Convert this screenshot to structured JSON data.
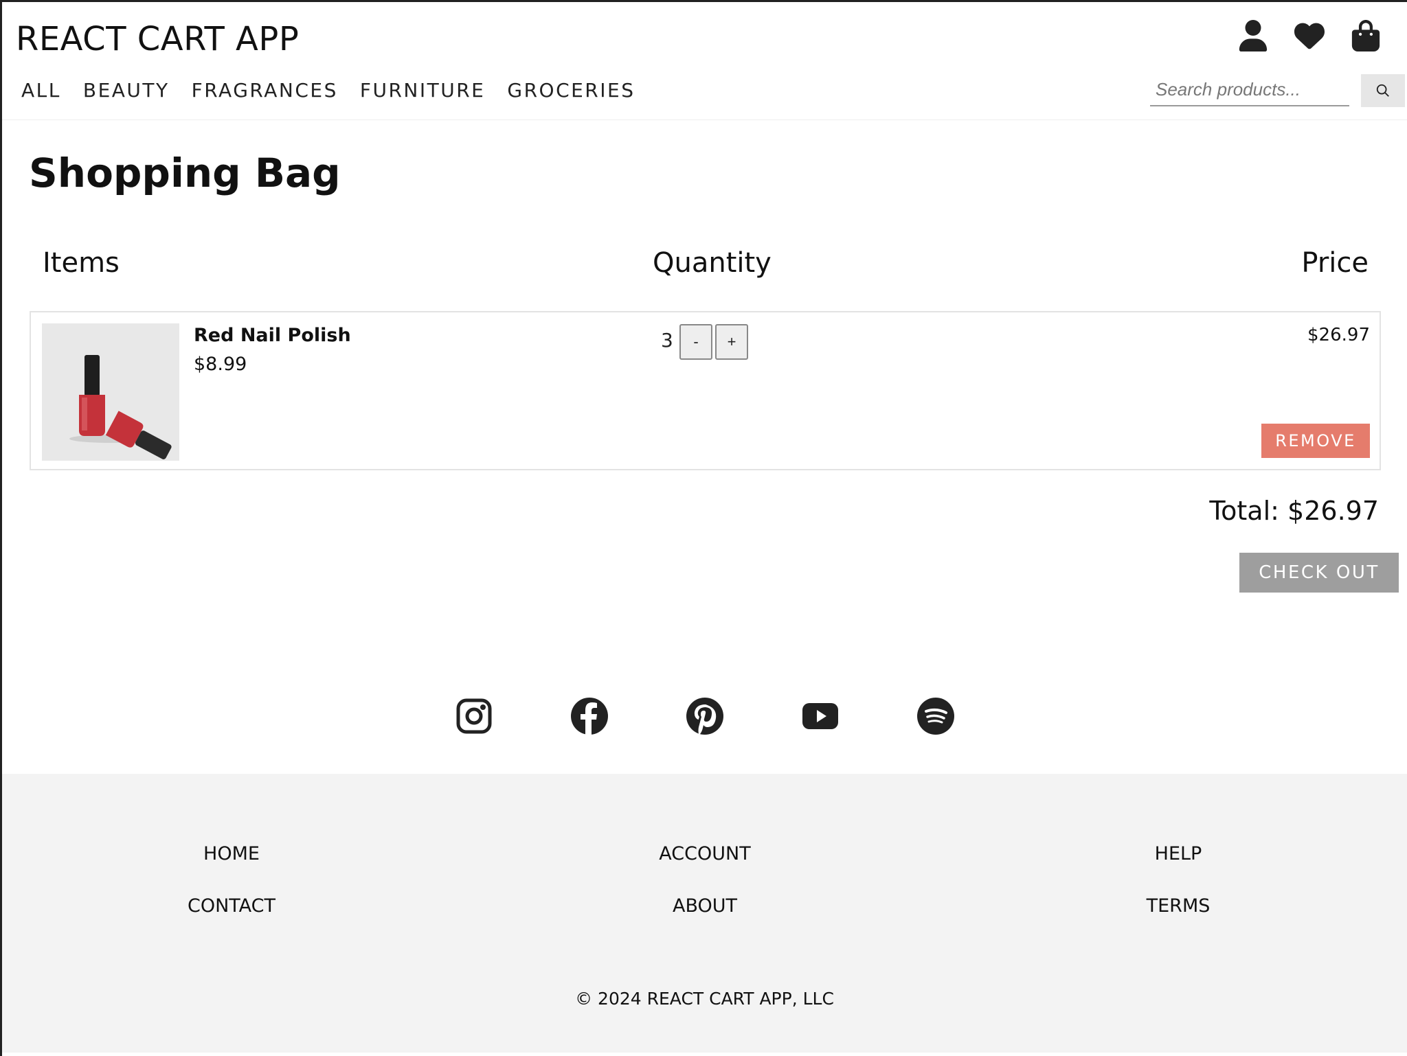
{
  "header": {
    "brand": "REACT CART APP",
    "icons": [
      "user-icon",
      "heart-icon",
      "shopping-bag-icon"
    ],
    "nav": [
      {
        "label": "ALL"
      },
      {
        "label": "BEAUTY"
      },
      {
        "label": "FRAGRANCES"
      },
      {
        "label": "FURNITURE"
      },
      {
        "label": "GROCERIES"
      }
    ],
    "search": {
      "placeholder": "Search products...",
      "value": ""
    }
  },
  "main": {
    "title": "Shopping Bag",
    "columns": {
      "items": "Items",
      "quantity": "Quantity",
      "price": "Price"
    },
    "cart_items": [
      {
        "name": "Red Nail Polish",
        "unit_price": "$8.99",
        "quantity": "3",
        "line_total": "$26.97",
        "minus_label": "-",
        "plus_label": "+",
        "remove_label": "REMOVE"
      }
    ],
    "total": "Total: $26.97",
    "checkout_label": "CHECK OUT"
  },
  "social": [
    "instagram-icon",
    "facebook-icon",
    "pinterest-icon",
    "youtube-icon",
    "spotify-icon"
  ],
  "footer": {
    "links": [
      {
        "label": "HOME"
      },
      {
        "label": "ACCOUNT"
      },
      {
        "label": "HELP"
      },
      {
        "label": "CONTACT"
      },
      {
        "label": "ABOUT"
      },
      {
        "label": "TERMS"
      }
    ],
    "copyright": "© 2024 REACT CART APP, LLC"
  },
  "colors": {
    "remove_button": "#e57c6c",
    "checkout_button": "#9e9e9e",
    "footer_bg": "#f3f3f3",
    "icon": "#222222"
  }
}
